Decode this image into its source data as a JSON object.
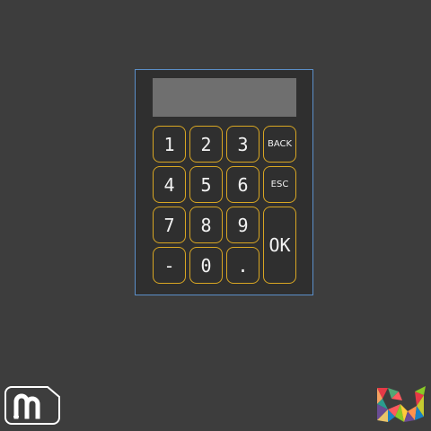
{
  "display": {
    "value": ""
  },
  "keys": {
    "k1": "1",
    "k2": "2",
    "k3": "3",
    "back": "BACK",
    "k4": "4",
    "k5": "5",
    "k6": "6",
    "esc": "ESC",
    "k7": "7",
    "k8": "8",
    "k9": "9",
    "ok": "OK",
    "minus": "-",
    "k0": "0",
    "dot": "."
  },
  "colors": {
    "background": "#3d3d3d",
    "panel": "#2f2f2f",
    "panel_border": "#5b8fc9",
    "display": "#6f6f6f",
    "key_border": "#d8a623"
  },
  "icons": {
    "bottom_left": "m-logo-icon",
    "bottom_right": "colorful-w-logo-icon"
  }
}
